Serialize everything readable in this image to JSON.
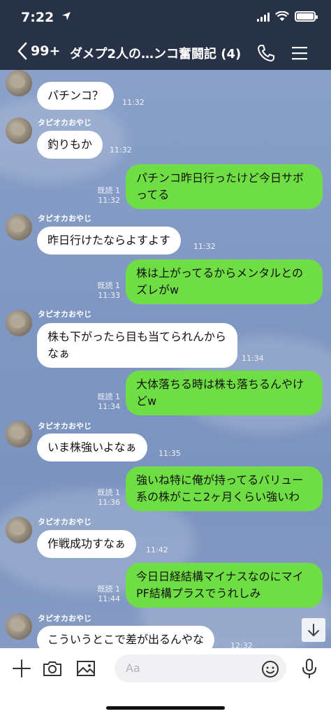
{
  "status": {
    "time": "7:22",
    "location_icon": "location-arrow-icon"
  },
  "header": {
    "back_count": "99+",
    "title": "ダメプ2人の…ンコ奮闘記 (4)",
    "colors": {
      "bg": "#273246",
      "text": "#ffffff"
    }
  },
  "chat": {
    "sender_name": "タピオカおやじ",
    "messages": [
      {
        "side": "in",
        "text": "パチンコ？",
        "time": "11:32"
      },
      {
        "side": "in",
        "text": "釣りもか",
        "time": "11:32"
      },
      {
        "side": "out",
        "text": "パチンコ昨日行ったけど今日サボってる",
        "read": "既読 1",
        "time": "11:32"
      },
      {
        "side": "in",
        "text": "昨日行けたならよすよす",
        "time": "11:32"
      },
      {
        "side": "out",
        "text": "株は上がってるからメンタルとのズレがw",
        "read": "既読 1",
        "time": "11:33"
      },
      {
        "side": "in",
        "text": "株も下がったら目も当てられんからなぁ",
        "time": "11:34"
      },
      {
        "side": "out",
        "text": "大体落ちる時は株も落ちるんやけどw",
        "read": "既読 1",
        "time": "11:34"
      },
      {
        "side": "in",
        "text": "いま株強いよなぁ",
        "time": "11:35"
      },
      {
        "side": "out",
        "text": "強いね特に俺が持ってるバリュー系の株がここ2ヶ月くらい強いわ",
        "read": "既読 1",
        "time": "11:36"
      },
      {
        "side": "in",
        "text": "作戦成功すなぁ",
        "time": "11:42"
      },
      {
        "side": "out",
        "text": "今日日経結構マイナスなのにマイPF結構プラスでうれしみ",
        "read": "既読 1",
        "time": "11:44"
      },
      {
        "side": "in",
        "text": "こういうとこで差が出るんやな",
        "time": "12:32"
      }
    ],
    "colors": {
      "outgoing": "#6fde44",
      "incoming": "#ffffff"
    }
  },
  "input": {
    "placeholder": "Aa"
  }
}
